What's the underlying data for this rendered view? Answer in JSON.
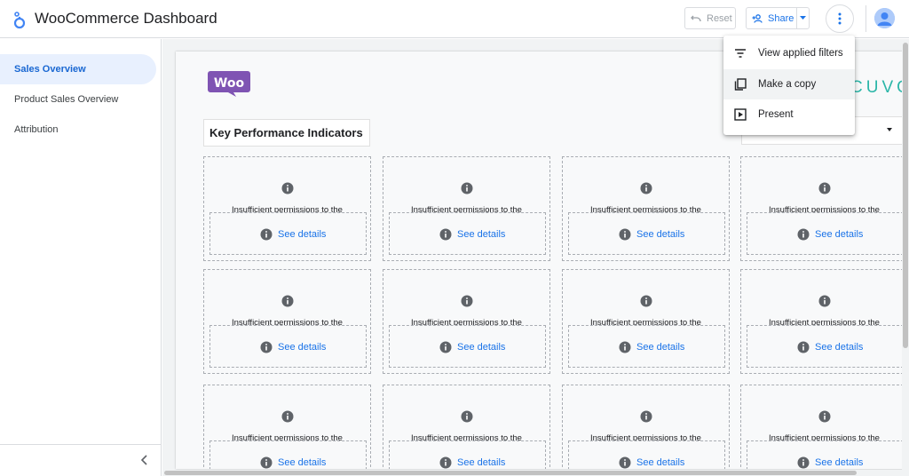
{
  "app": {
    "title": "WooCommerce Dashboard"
  },
  "toolbar": {
    "reset_label": "Reset",
    "share_label": "Share",
    "colors": {
      "share": "#1a73e8",
      "disabled": "#9aa0a6"
    }
  },
  "sidebar": {
    "items": [
      {
        "label": "Sales Overview",
        "active": true
      },
      {
        "label": "Product Sales Overview",
        "active": false
      },
      {
        "label": "Attribution",
        "active": false
      }
    ],
    "collapse_icon": "chevron-left-icon"
  },
  "report": {
    "brand_logo_text": "Woo",
    "partner_logo_text": "CUVO",
    "kpi_title": "Key Performance Indicators",
    "tile_message": "Insufficient permissions to the",
    "tile_link": "See details",
    "tile_icon": "info-icon"
  },
  "menu": {
    "items": [
      {
        "label": "View applied filters",
        "icon": "filter-list-icon"
      },
      {
        "label": "Make a copy",
        "icon": "copy-icon"
      },
      {
        "label": "Present",
        "icon": "present-icon"
      }
    ]
  }
}
